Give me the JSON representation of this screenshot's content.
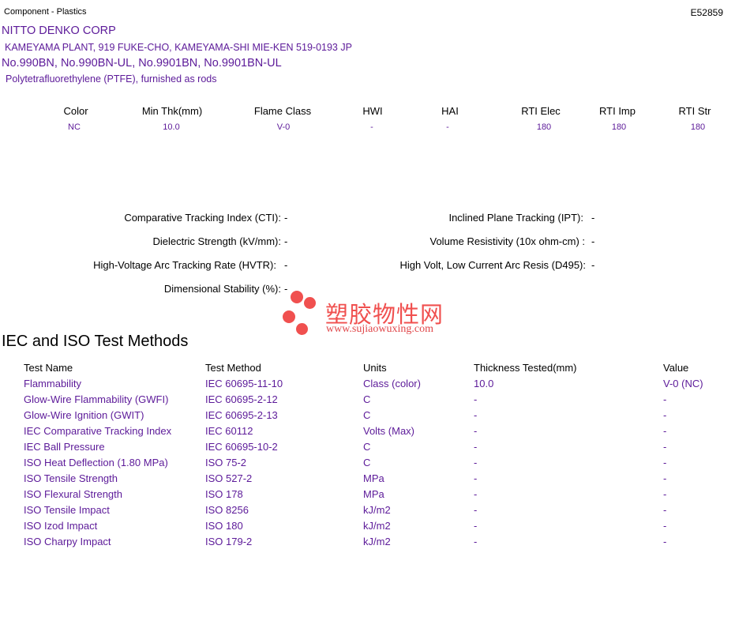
{
  "header": {
    "category": "Component - Plastics",
    "file_number": "E52859"
  },
  "company": {
    "name": "NITTO DENKO CORP",
    "address": "KAMEYAMA PLANT, 919 FUKE-CHO, KAMEYAMA-SHI  MIE-KEN  519-0193 JP",
    "products": "No.990BN, No.990BN-UL, No.9901BN, No.9901BN-UL",
    "description": "Polytetrafluorethylene (PTFE), furnished as rods"
  },
  "properties": {
    "headers": [
      "Color",
      "Min Thk(mm)",
      "Flame Class",
      "HWI",
      "HAI",
      "RTI Elec",
      "RTI Imp",
      "RTI Str"
    ],
    "values": [
      "NC",
      "10.0",
      "V-0",
      "-",
      "-",
      "180",
      "180",
      "180"
    ]
  },
  "electrical": {
    "left": [
      {
        "label": "Comparative Tracking Index (CTI):",
        "value": "-"
      },
      {
        "label": "Dielectric Strength (kV/mm):",
        "value": "-"
      },
      {
        "label": "High-Voltage Arc Tracking Rate (HVTR):",
        "value": "-"
      },
      {
        "label": "Dimensional Stability (%):",
        "value": "-"
      }
    ],
    "right": [
      {
        "label": "Inclined Plane Tracking (IPT):",
        "value": "-"
      },
      {
        "label": "Volume Resistivity (10x ohm-cm) :",
        "value": "-"
      },
      {
        "label": "High Volt, Low Current Arc Resis (D495):",
        "value": "-"
      }
    ]
  },
  "watermark": {
    "name": "塑胶物性网",
    "url": "www.sujiaowuxing.com",
    "color": "#f0504f"
  },
  "test_methods": {
    "title": "IEC and ISO Test Methods",
    "columns": [
      "Test Name",
      "Test Method",
      "Units",
      "Thickness Tested(mm)",
      "Value"
    ],
    "rows": [
      [
        "Flammability",
        "IEC 60695-11-10",
        "Class (color)",
        "10.0",
        "V-0 (NC)"
      ],
      [
        "Glow-Wire Flammability (GWFI)",
        "IEC 60695-2-12",
        "C",
        "-",
        "-"
      ],
      [
        "Glow-Wire Ignition (GWIT)",
        "IEC 60695-2-13",
        "C",
        "-",
        "-"
      ],
      [
        "IEC Comparative Tracking Index",
        "IEC 60112",
        "Volts (Max)",
        "-",
        "-"
      ],
      [
        "IEC Ball Pressure",
        "IEC 60695-10-2",
        "C",
        "-",
        "-"
      ],
      [
        "ISO Heat Deflection (1.80 MPa)",
        "ISO 75-2",
        "C",
        "-",
        "-"
      ],
      [
        "ISO Tensile Strength",
        "ISO 527-2",
        "MPa",
        "-",
        "-"
      ],
      [
        "ISO Flexural Strength",
        "ISO 178",
        "MPa",
        "-",
        "-"
      ],
      [
        "ISO Tensile Impact",
        "ISO 8256",
        "kJ/m2",
        "-",
        "-"
      ],
      [
        "ISO Izod Impact",
        "ISO 180",
        "kJ/m2",
        "-",
        "-"
      ],
      [
        "ISO Charpy Impact",
        "ISO 179-2",
        "kJ/m2",
        "-",
        "-"
      ]
    ]
  },
  "colors": {
    "text_primary": "#000000",
    "text_accent": "#5c1a99"
  }
}
